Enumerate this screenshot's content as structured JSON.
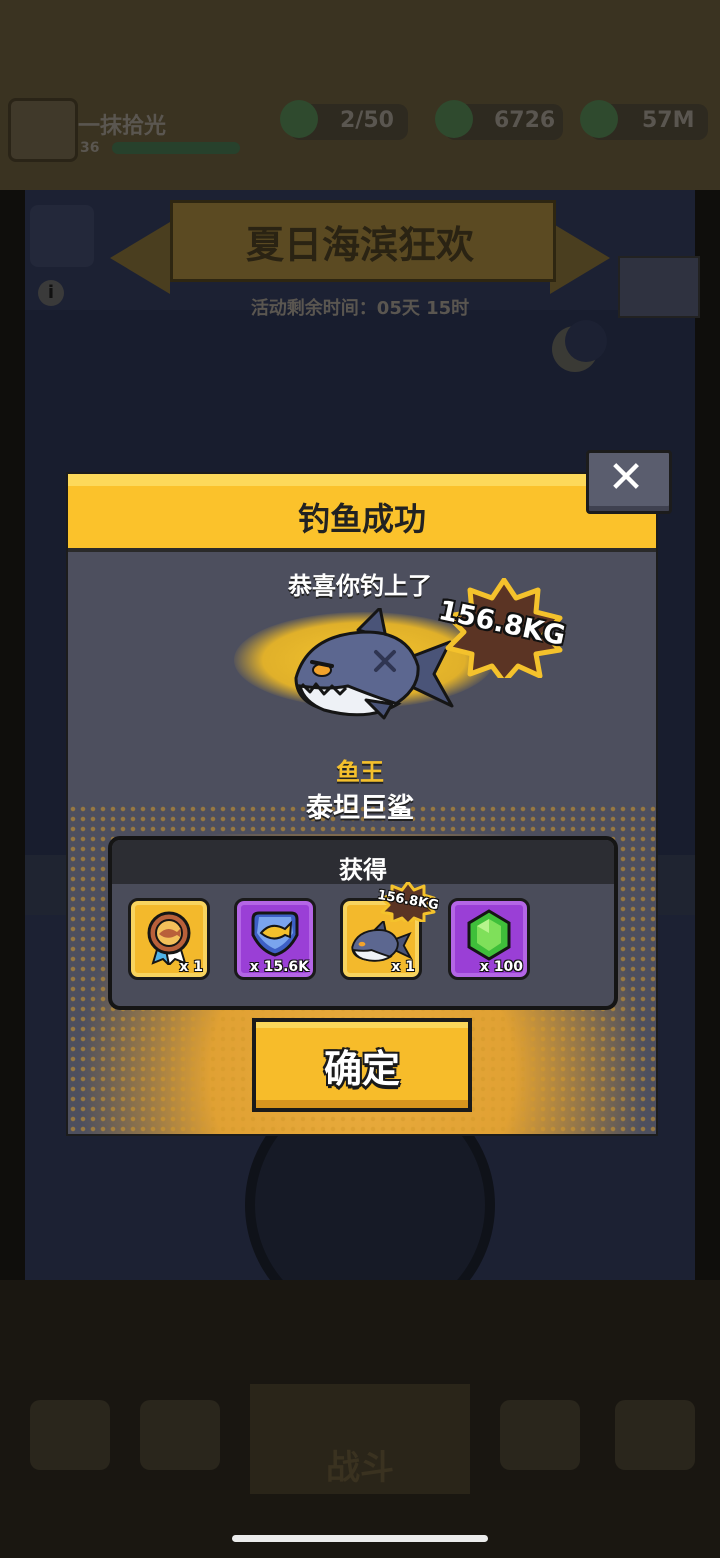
{
  "background": {
    "player": {
      "name": "一抹拾光",
      "level": "36"
    },
    "resources": [
      {
        "icon": "energy-icon",
        "value": "2/50"
      },
      {
        "icon": "cash-icon",
        "value": "6726"
      },
      {
        "icon": "coin-icon",
        "value": "57M"
      }
    ],
    "event_title": "夏日海滨狂欢",
    "countdown": "活动剩余时间：05天 15时",
    "nav": {
      "fight_label": "战斗"
    }
  },
  "modal": {
    "title": "钓鱼成功",
    "congrats": "恭喜你钓上了",
    "weight": "156.8KG",
    "rank": "鱼王",
    "fish_name": "泰坦巨鲨",
    "obtain_label": "获得",
    "rewards": [
      {
        "icon": "fish-king-medal-icon",
        "quantity": "x 1",
        "frame": "gold"
      },
      {
        "icon": "fish-badge-icon",
        "quantity": "x 15.6K",
        "frame": "purple"
      },
      {
        "icon": "titan-shark-icon",
        "quantity": "x 1",
        "frame": "gold",
        "weight": "156.8KG"
      },
      {
        "icon": "green-gem-icon",
        "quantity": "x 100",
        "frame": "purple"
      }
    ],
    "confirm_label": "确定",
    "close_symbol": "✕"
  },
  "colors": {
    "accent_yellow": "#fbc22b",
    "rank_gold": "#f5c02c",
    "modal_body": "#4d4f5e",
    "reward_purple": "#9a3fd6"
  }
}
